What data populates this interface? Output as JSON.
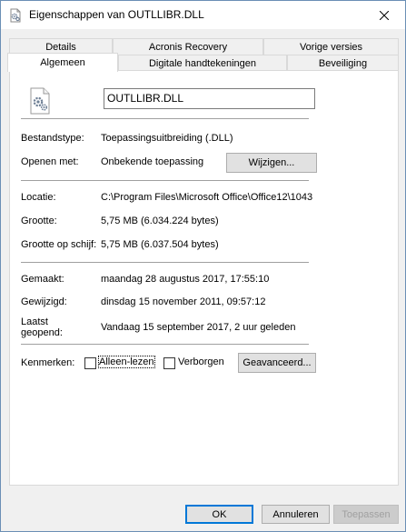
{
  "window": {
    "title": "Eigenschappen van OUTLLIBR.DLL"
  },
  "tabs": {
    "row1": [
      "Details",
      "Acronis Recovery",
      "Vorige versies"
    ],
    "row2": [
      "Algemeen",
      "Digitale handtekeningen",
      "Beveiliging"
    ],
    "active": "Algemeen"
  },
  "general": {
    "file_name": "OUTLLIBR.DLL",
    "file_type_label": "Bestandstype:",
    "file_type_value": "Toepassingsuitbreiding (.DLL)",
    "opens_with_label": "Openen met:",
    "opens_with_value": "Onbekende toepassing",
    "change_button": "Wijzigen...",
    "location_label": "Locatie:",
    "location_value": "C:\\Program Files\\Microsoft Office\\Office12\\1043",
    "size_label": "Grootte:",
    "size_value": "5,75 MB (6.034.224 bytes)",
    "size_on_disk_label": "Grootte op schijf:",
    "size_on_disk_value": "5,75 MB (6.037.504 bytes)",
    "created_label": "Gemaakt:",
    "created_value": "maandag 28 augustus 2017, 17:55:10",
    "modified_label": "Gewijzigd:",
    "modified_value": "dinsdag 15 november 2011, 09:57:12",
    "accessed_label_line1": "Laatst",
    "accessed_label_line2": "geopend:",
    "accessed_value": "Vandaag 15 september 2017, 2 uur geleden",
    "attributes_label": "Kenmerken:",
    "readonly_label": "Alleen-lezen",
    "readonly_checked": false,
    "hidden_label": "Verborgen",
    "hidden_checked": false,
    "advanced_button": "Geavanceerd..."
  },
  "footer": {
    "ok": "OK",
    "cancel": "Annuleren",
    "apply": "Toepassen"
  },
  "colors": {
    "accent": "#0078d7",
    "window_bg": "#f0f0f0",
    "panel_bg": "#ffffff"
  }
}
